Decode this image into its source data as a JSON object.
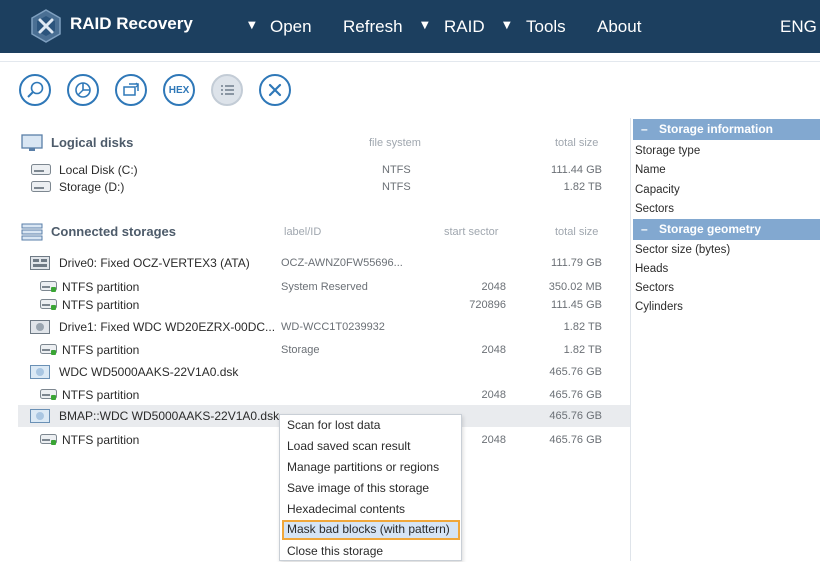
{
  "header": {
    "app_title": "RAID Recovery",
    "menu": [
      {
        "label": "Open",
        "has_arrow": true
      },
      {
        "label": "Refresh",
        "has_arrow": false
      },
      {
        "label": "RAID",
        "has_arrow": true
      },
      {
        "label": "Tools",
        "has_arrow": true
      },
      {
        "label": "About",
        "has_arrow": false
      }
    ],
    "language": "ENG"
  },
  "toolbar": {
    "hex_label": "HEX",
    "buttons": [
      "search-icon",
      "pie-chart-icon",
      "swap-icon",
      "hex-icon",
      "list-icon",
      "close-icon"
    ]
  },
  "logical_disks": {
    "title": "Logical disks",
    "col_filesystem": "file system",
    "col_totalsize": "total size",
    "rows": [
      {
        "name": "Local Disk (C:)",
        "fs": "NTFS",
        "size": "111.44 GB"
      },
      {
        "name": "Storage (D:)",
        "fs": "NTFS",
        "size": "1.82 TB"
      }
    ]
  },
  "connected_storages": {
    "title": "Connected storages",
    "col_label": "label/ID",
    "col_start": "start sector",
    "col_totalsize": "total size",
    "rows": [
      {
        "name": "Drive0: Fixed OCZ-VERTEX3 (ATA)",
        "label": "OCZ-AWNZ0FW55696...",
        "start": "",
        "size": "111.79 GB",
        "level": 0,
        "icon": "ssd-icon"
      },
      {
        "name": "NTFS partition",
        "label": "System Reserved",
        "start": "2048",
        "size": "350.02 MB",
        "level": 1,
        "icon": "partition-icon"
      },
      {
        "name": "NTFS partition",
        "label": "",
        "start": "720896",
        "size": "111.45 GB",
        "level": 1,
        "icon": "partition-icon"
      },
      {
        "name": "Drive1: Fixed WDC WD20EZRX-00DC...",
        "label": "WD-WCC1T0239932",
        "start": "",
        "size": "1.82 TB",
        "level": 0,
        "icon": "hdd-icon"
      },
      {
        "name": "NTFS partition",
        "label": "Storage",
        "start": "2048",
        "size": "1.82 TB",
        "level": 1,
        "icon": "partition-icon"
      },
      {
        "name": "WDC WD5000AAKS-22V1A0.dsk",
        "label": "",
        "start": "",
        "size": "465.76 GB",
        "level": 0,
        "icon": "image-file-icon"
      },
      {
        "name": "NTFS partition",
        "label": "",
        "start": "2048",
        "size": "465.76 GB",
        "level": 1,
        "icon": "partition-icon"
      },
      {
        "name": "BMAP::WDC WD5000AAKS-22V1A0.dsk",
        "label": "",
        "start": "",
        "size": "465.76 GB",
        "level": 0,
        "icon": "image-file-icon",
        "selected": true
      },
      {
        "name": "NTFS partition",
        "label": "",
        "start": "2048",
        "size": "465.76 GB",
        "level": 1,
        "icon": "partition-icon"
      }
    ]
  },
  "sidebar": {
    "storage_info_title": "Storage information",
    "storage_info_items": [
      "Storage type",
      "Name",
      "Capacity",
      "Sectors"
    ],
    "geometry_title": "Storage geometry",
    "geometry_items": [
      "Sector size (bytes)",
      "Heads",
      "Sectors",
      "Cylinders"
    ],
    "collapse_symbol": "–"
  },
  "context_menu": {
    "items": [
      {
        "label": "Scan for lost data",
        "highlighted": false
      },
      {
        "label": "Load saved scan result",
        "highlighted": false
      },
      {
        "label": "Manage partitions or regions",
        "highlighted": false
      },
      {
        "label": "Save image of this storage",
        "highlighted": false
      },
      {
        "label": "Hexadecimal contents",
        "highlighted": false
      },
      {
        "label": "Mask bad blocks (with pattern)",
        "highlighted": true
      },
      {
        "label": "Close this storage",
        "highlighted": false
      }
    ]
  },
  "colors": {
    "topbar": "#1c3f5f",
    "accent": "#2f78b8",
    "sidebar_header": "#82a8d0",
    "highlight_border": "#f0a73a",
    "partition_green": "#3aa535"
  }
}
